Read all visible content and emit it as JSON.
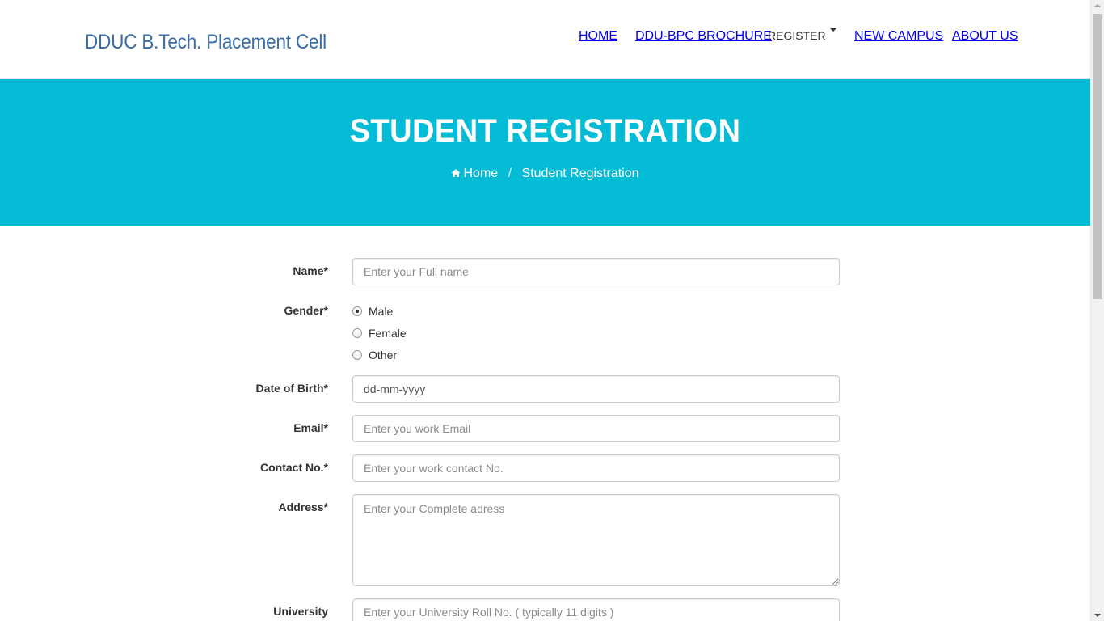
{
  "navbar": {
    "brand": "DDUC B.Tech. Placement Cell",
    "items": [
      {
        "label": "HOME"
      },
      {
        "label": "DDU-BPC BROCHURE"
      },
      {
        "label": "REGISTER"
      },
      {
        "label": "NEW CAMPUS"
      },
      {
        "label": "ABOUT US"
      }
    ]
  },
  "banner": {
    "title": "STUDENT REGISTRATION",
    "breadcrumb": {
      "home": "Home",
      "separator": "/",
      "current": "Student Registration"
    },
    "color": "#05bcd6"
  },
  "form": {
    "name": {
      "label": "Name*",
      "placeholder": "Enter your Full name"
    },
    "gender": {
      "label": "Gender*",
      "options": [
        {
          "label": "Male",
          "checked": true
        },
        {
          "label": "Female",
          "checked": false
        },
        {
          "label": "Other",
          "checked": false
        }
      ]
    },
    "dob": {
      "label": "Date of Birth*",
      "value": "dd-mm-yyyy"
    },
    "email": {
      "label": "Email*",
      "placeholder": "Enter you work Email"
    },
    "contact": {
      "label": "Contact No.*",
      "placeholder": "Enter your work contact No."
    },
    "address": {
      "label": "Address*",
      "placeholder": "Enter your Complete adress"
    },
    "university": {
      "label": "University",
      "placeholder": "Enter your University Roll No. ( typically 11 digits )"
    }
  }
}
